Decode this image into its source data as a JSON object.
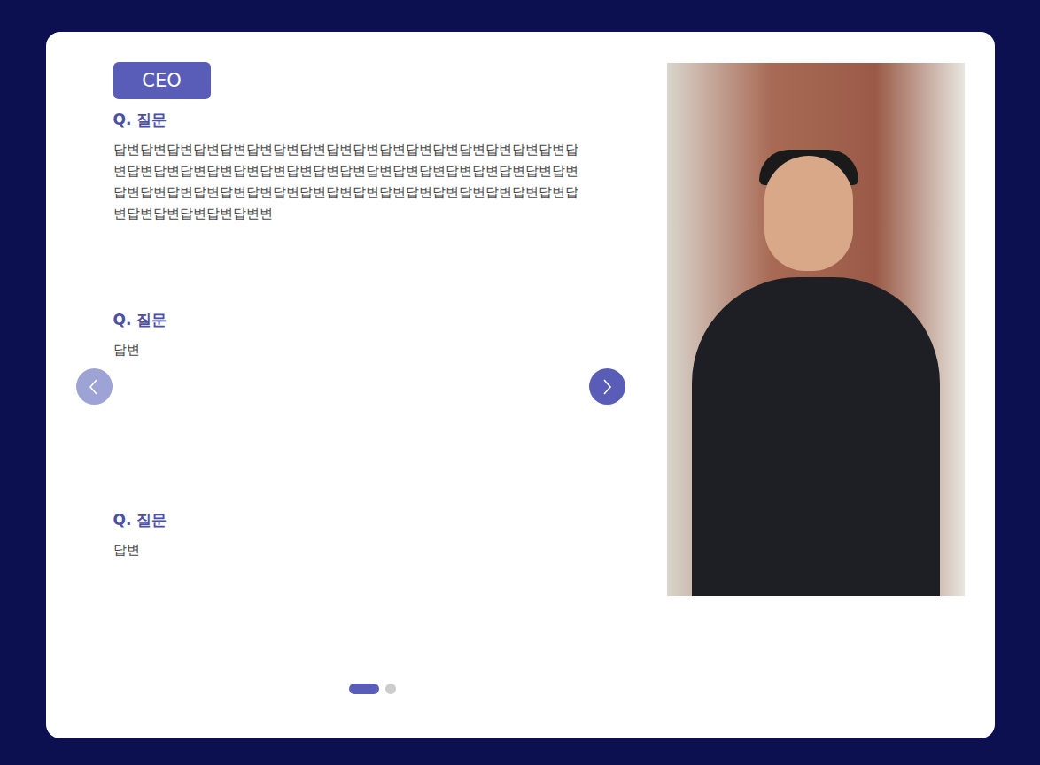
{
  "badge": "CEO",
  "qa": [
    {
      "question": "Q. 질문",
      "answer": "답변답변답변답변답변답변답변답변답변답변답변답변답변답변답변답변답변답변답변답변답변답변답변답변답변답변답변답변답변답변답변답변답변답변답변답변답변답변답변답변답변답변답변답변답변답변답변답변답변답변답변답변답변답변답변답변답변답변변"
    },
    {
      "question": "Q. 질문",
      "answer": "답변"
    },
    {
      "question": "Q. 질문",
      "answer": "답변"
    }
  ],
  "prev_button": {
    "disabled": true
  },
  "next_button": {
    "disabled": false
  },
  "pages": [
    {
      "selected": true
    },
    {
      "selected": false
    }
  ]
}
